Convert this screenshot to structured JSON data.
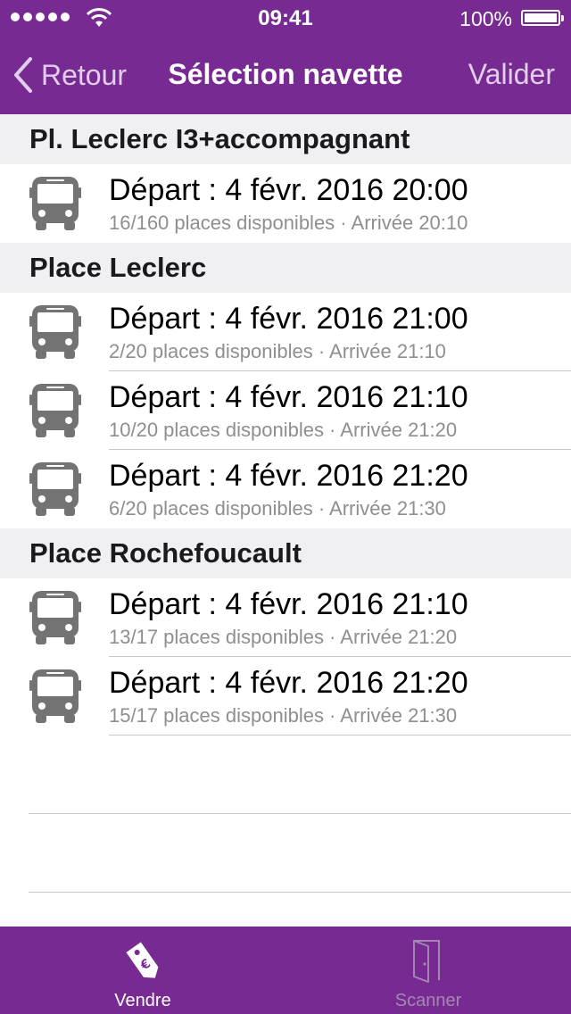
{
  "status_bar": {
    "time": "09:41",
    "battery": "100%"
  },
  "nav": {
    "back_label": "Retour",
    "title": "Sélection navette",
    "validate_label": "Valider"
  },
  "sections": [
    {
      "title": "Pl. Leclerc I3+accompagnant",
      "rows": [
        {
          "title": "Départ : 4 févr. 2016 20:00",
          "subtitle": "16/160 places disponibles · Arrivée 20:10"
        }
      ]
    },
    {
      "title": "Place Leclerc",
      "rows": [
        {
          "title": "Départ : 4 févr. 2016 21:00",
          "subtitle": "2/20 places disponibles · Arrivée 21:10"
        },
        {
          "title": "Départ : 4 févr. 2016 21:10",
          "subtitle": "10/20 places disponibles · Arrivée 21:20"
        },
        {
          "title": "Départ : 4 févr. 2016 21:20",
          "subtitle": "6/20 places disponibles · Arrivée 21:30"
        }
      ]
    },
    {
      "title": "Place Rochefoucault",
      "rows": [
        {
          "title": "Départ : 4 févr. 2016 21:10",
          "subtitle": "13/17 places disponibles · Arrivée 21:20"
        },
        {
          "title": "Départ : 4 févr. 2016 21:20",
          "subtitle": "15/17 places disponibles · Arrivée 21:30"
        }
      ]
    }
  ],
  "tabs": [
    {
      "label": "Vendre",
      "icon": "price-tag-euro-icon",
      "active": true
    },
    {
      "label": "Scanner",
      "icon": "door-icon",
      "active": false
    }
  ],
  "colors": {
    "brand": "#772b92",
    "section_bg": "#efeff4",
    "secondary_text": "#8e8e93",
    "icon_gray": "#737373"
  }
}
